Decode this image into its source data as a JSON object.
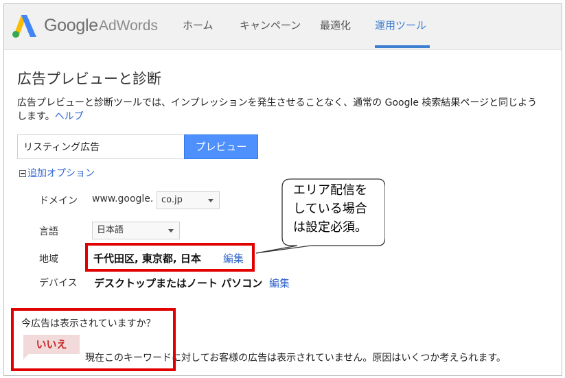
{
  "header": {
    "logo_text": "Google",
    "logo_product": "AdWords",
    "nav": [
      "ホーム",
      "キャンペーン",
      "最適化",
      "運用ツール"
    ],
    "active_nav": "運用ツール",
    "accent_color": "#3f7fd1"
  },
  "page": {
    "title": "広告プレビューと診断",
    "description_line1": "広告プレビューと診断ツールでは、インプレッションを発生させることなく、通常の Google 検索結果ページと同じよう",
    "description_line2_prefix": "します。",
    "help_link": "ヘルプ"
  },
  "search": {
    "value": "リスティング広告",
    "button_label": "プレビュー"
  },
  "options": {
    "toggle_label": "追加オプション",
    "domain_label": "ドメイン",
    "domain_prefix": "www.google.",
    "domain_value": "co.jp",
    "language_label": "言語",
    "language_value": "日本語",
    "region_label": "地域",
    "region_value": "千代田区, 東京都, 日本",
    "device_label": "デバイス",
    "device_value": "デスクトップまたはノート パソコン",
    "edit_label": "編集"
  },
  "callout": {
    "line1": "エリア配信を",
    "line2": "している場合",
    "line3": "は設定必須。"
  },
  "result": {
    "question": "今広告は表示されていますか？",
    "answer": "いいえ",
    "message": "現在このキーワードに対してお客様の広告は表示されていません。原因はいくつか考えられます。"
  },
  "colors": {
    "highlight_red": "#e00000",
    "link_blue": "#3366cc",
    "button_blue": "#4d90fe"
  },
  "icons": [
    "adwords-logo-icon",
    "collapse-box-icon",
    "dropdown-caret-icon",
    "speech-bubble-icon"
  ]
}
